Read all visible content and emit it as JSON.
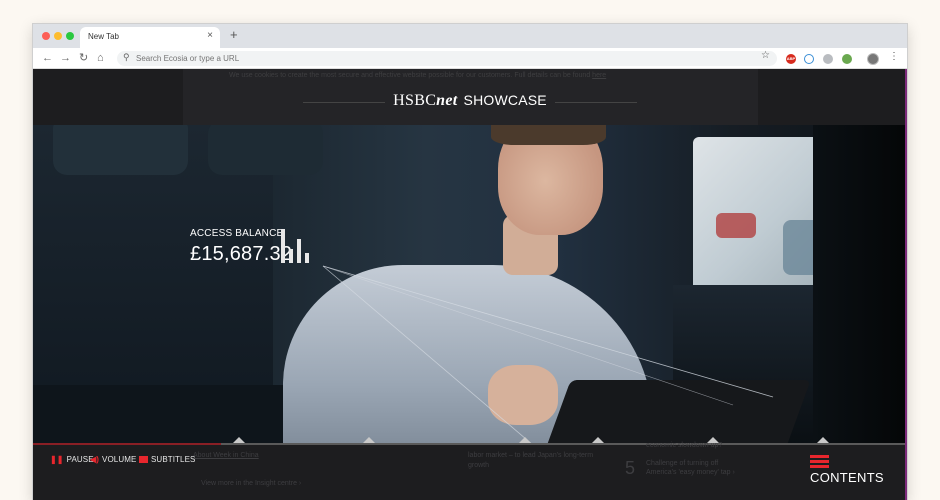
{
  "browser": {
    "tab_title": "New Tab",
    "new_tab_symbol": "+",
    "close_symbol": "×",
    "address_placeholder": "Search Ecosia or type a URL",
    "extensions": [
      "abp-icon",
      "shield-icon",
      "cloud-icon",
      "globe-icon"
    ],
    "abp_label": "ABP"
  },
  "page": {
    "cookie_notice": "We use cookies to create the most secure and effective website possible for our customers. Full details can be found",
    "cookie_link": "here",
    "header": {
      "brand_main": "HSBC",
      "brand_emphasis": "net",
      "brand_suffix": "SHOWCASE"
    },
    "balance": {
      "label": "ACCESS BALANCE",
      "value": "£15,687.32",
      "bar_levels": [
        1.0,
        0.4,
        0.7,
        0.3
      ]
    },
    "timeline": {
      "progress": 0.215,
      "markers": [
        0.236,
        0.385,
        0.563,
        0.646,
        0.778,
        0.904
      ]
    },
    "controls": {
      "pause_label": "PAUSE",
      "volume_label": "VOLUME",
      "subtitles_label": "SUBTITLES",
      "contents_label": "CONTENTS"
    },
    "background_text": {
      "link1": "About Week in China",
      "link2": "View more in the Insight centre ›",
      "mid_text_1": "labor market – to lead Japan's long-term",
      "mid_text_2": "growth",
      "right_text_1": "economic slowdown up?",
      "right_number": "5",
      "right_text_2": "Challenge of turning off",
      "right_text_3": "America's 'easy money' tap ›"
    }
  },
  "colors": {
    "accent_red": "#e8262d",
    "progress_red": "#8a1f25",
    "page_bg": "#1d1d1f"
  }
}
